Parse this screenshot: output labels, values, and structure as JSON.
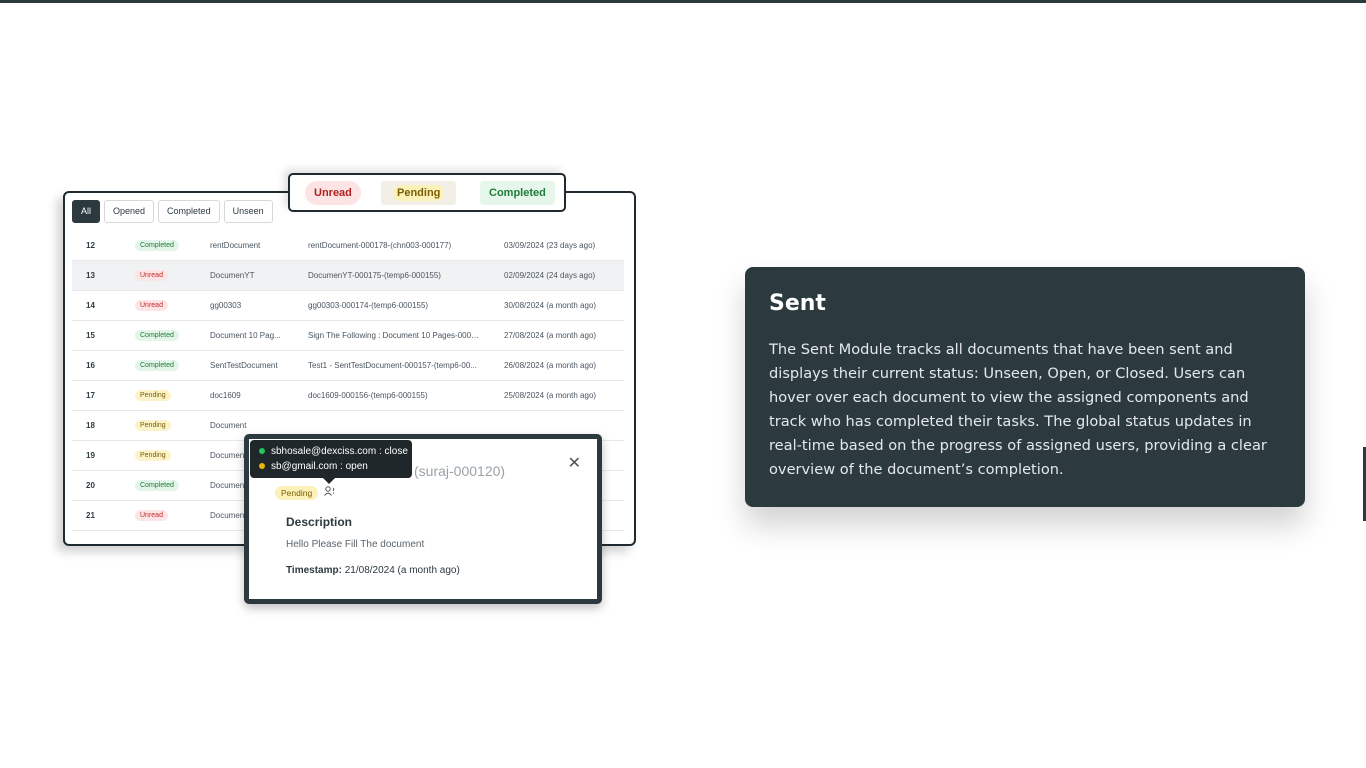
{
  "filters": [
    {
      "label": "All",
      "active": true
    },
    {
      "label": "Opened",
      "active": false
    },
    {
      "label": "Completed",
      "active": false
    },
    {
      "label": "Unseen",
      "active": false
    }
  ],
  "rows": [
    {
      "num": "12",
      "status": "Completed",
      "name": "rentDocument",
      "file": "rentDocument-000178-(chn003-000177)",
      "date": "03/09/2024 (23 days ago)"
    },
    {
      "num": "13",
      "status": "Unread",
      "name": "DocumenYT",
      "file": "DocumenYT-000175-(temp6-000155)",
      "date": "02/09/2024 (24 days ago)"
    },
    {
      "num": "14",
      "status": "Unread",
      "name": "gg00303",
      "file": "gg00303-000174-(temp6-000155)",
      "date": "30/08/2024 (a month ago)"
    },
    {
      "num": "15",
      "status": "Completed",
      "name": "Document 10 Pag...",
      "file": "Sign The Following : Document 10 Pages-0001...",
      "date": "27/08/2024 (a month ago)"
    },
    {
      "num": "16",
      "status": "Completed",
      "name": "SentTestDocument",
      "file": "Test1 - SentTestDocument-000157-(temp6-00...",
      "date": "26/08/2024 (a month ago)"
    },
    {
      "num": "17",
      "status": "Pending",
      "name": "doc1609",
      "file": "doc1609-000156-(temp6-000155)",
      "date": "25/08/2024 (a month ago)"
    },
    {
      "num": "18",
      "status": "Pending",
      "name": "Document",
      "file": "",
      "date": ""
    },
    {
      "num": "19",
      "status": "Pending",
      "name": "Documen",
      "file": "",
      "date": ""
    },
    {
      "num": "20",
      "status": "Completed",
      "name": "Documen",
      "file": "",
      "date": ""
    },
    {
      "num": "21",
      "status": "Unread",
      "name": "Documen",
      "file": "",
      "date": ""
    }
  ],
  "legend": {
    "unread": "Unread",
    "pending": "Pending",
    "completed": "Completed"
  },
  "popup": {
    "title": "(suraj-000120)",
    "status": "Pending",
    "description_heading": "Description",
    "description": "Hello Please Fill The document",
    "timestamp_label": "Timestamp:",
    "timestamp_value": "21/08/2024 (a month ago)"
  },
  "tooltip": [
    {
      "text": "sbhosale@dexciss.com : close",
      "color": "#22c55e"
    },
    {
      "text": "sb@gmail.com : open",
      "color": "#eab308"
    }
  ],
  "info": {
    "title": "Sent",
    "body": "The Sent Module tracks all documents that have been sent and displays their current status: Unseen, Open, or Closed. Users can hover over each document to view the assigned components and track who has completed their tasks. The global status updates in real-time based on the progress of assigned users, providing a clear overview of the document’s completion."
  }
}
